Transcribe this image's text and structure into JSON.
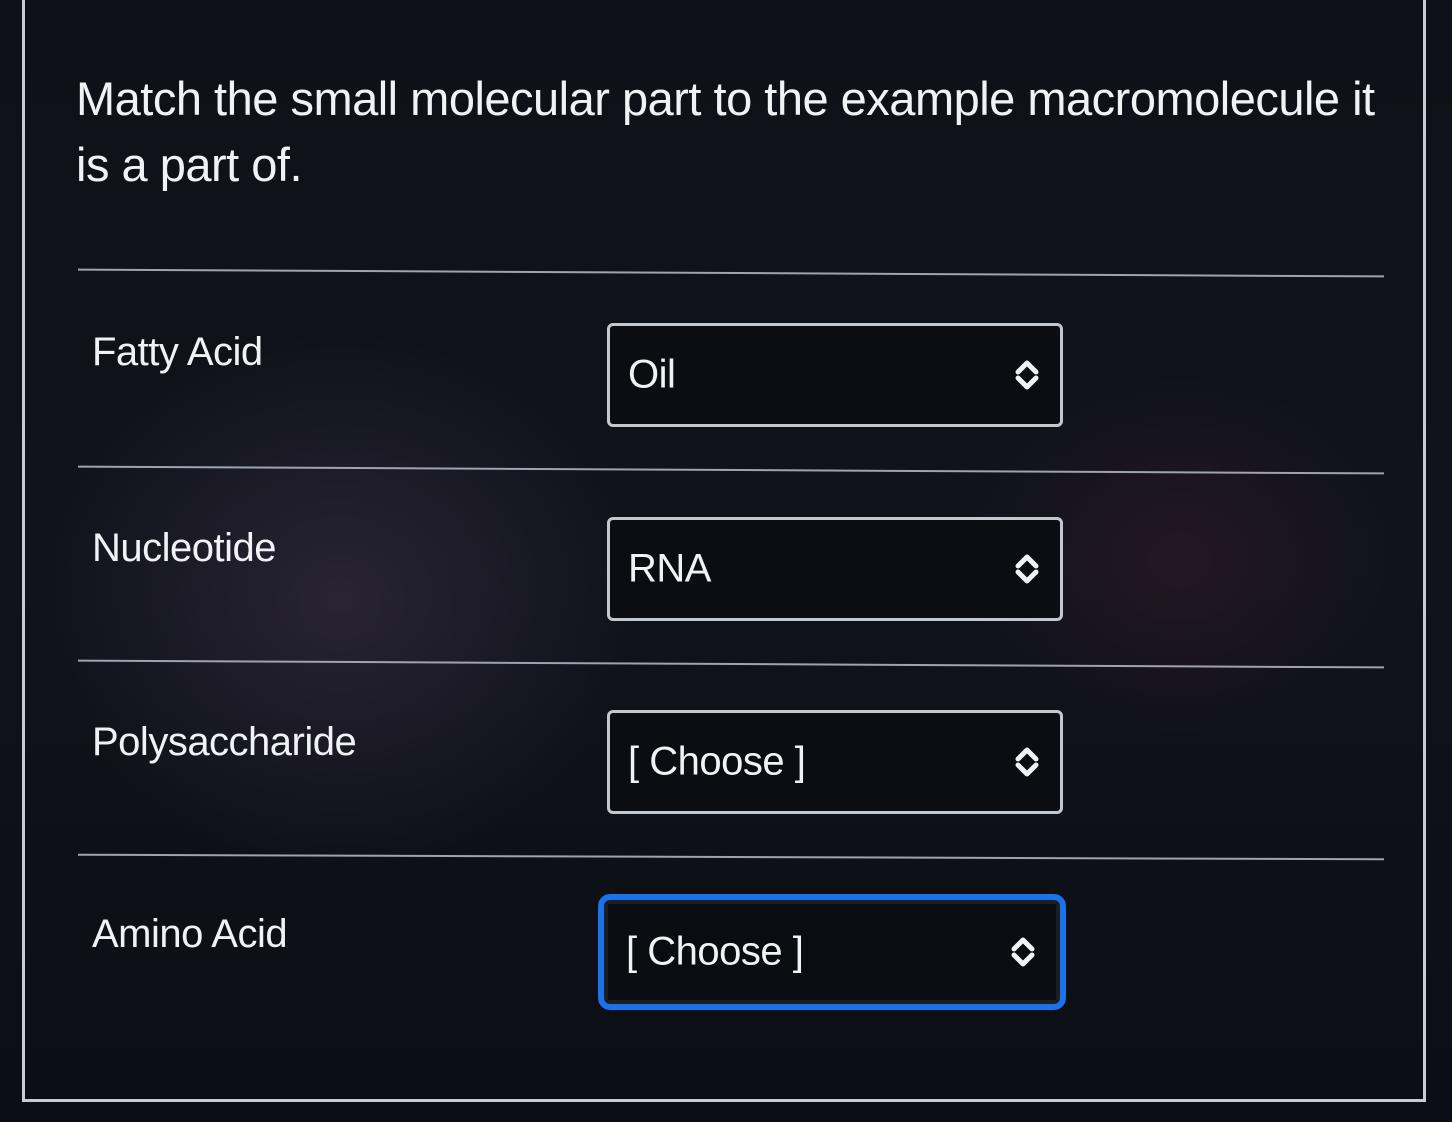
{
  "question": {
    "text": "Match the small molecular part to the example macromolecule it is a part of."
  },
  "rows": [
    {
      "label": "Fatty Acid",
      "selected": "Oil"
    },
    {
      "label": "Nucleotide",
      "selected": "RNA"
    },
    {
      "label": "Polysaccharide",
      "selected": "[ Choose ]"
    },
    {
      "label": "Amino Acid",
      "selected": "[ Choose ]"
    }
  ],
  "colors": {
    "background": "#0d0f16",
    "text": "#f1f2f5",
    "focus_ring": "#1a73e8"
  },
  "icons": {
    "select_arrow": "up-down-chevron-icon"
  }
}
